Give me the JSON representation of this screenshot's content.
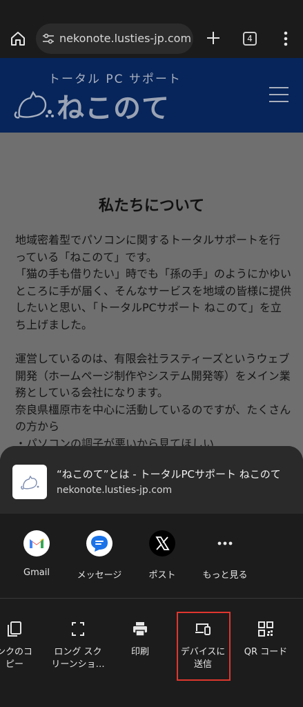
{
  "browser": {
    "url": "nekonote.lusties-jp.com/",
    "tab_count": "4",
    "icons": [
      "home-icon",
      "tune-icon",
      "plus-icon",
      "tabs-icon",
      "more-vert-icon"
    ]
  },
  "site": {
    "subtitle": "トータル PC サポート",
    "logo_text": "ねこのて",
    "page_title": "私たちについて",
    "paragraph_1": "地域密着型でパソコンに関するトータルサポートを行っている「ねこのて」です。\n「猫の手も借りたい」時でも「孫の手」のようにかゆいところに手が届く、そんなサービスを地域の皆様に提供したいと思い、「トータルPCサポート ねこのて」を立ち上げました。",
    "paragraph_2": "運営しているのは、有限会社ラスティーズというウェブ開発（ホームページ制作やシステム開発等）をメイン業務としている会社になります。\n奈良県橿原市を中心に活動しているのですが、たくさんの方から\n・パソコンの調子が悪いから見てほしい"
  },
  "share_sheet": {
    "title": "“ねこのて”とは - トータルPCサポート ねこのて",
    "url": "nekonote.lusties-jp.com",
    "apps": [
      {
        "label": "Gmail",
        "icon": "gmail-icon"
      },
      {
        "label": "メッセージ",
        "icon": "messages-icon"
      },
      {
        "label": "ポスト",
        "icon": "x-icon"
      },
      {
        "label": "もっと見る",
        "icon": "more-horiz-icon"
      }
    ],
    "actions": [
      {
        "label": "ンクのコ\nピー",
        "icon": "copy-icon"
      },
      {
        "label": "ロング スク\nリーンショ…",
        "icon": "screenshot-icon"
      },
      {
        "label": "印刷",
        "icon": "print-icon"
      },
      {
        "label": "デバイスに\n送信",
        "icon": "send-to-device-icon"
      },
      {
        "label": "QR コード",
        "icon": "qr-code-icon"
      }
    ]
  },
  "colors": {
    "site_header": "#07255a",
    "sheet_bg": "#1c1c1c",
    "highlight": "#e0372f"
  }
}
